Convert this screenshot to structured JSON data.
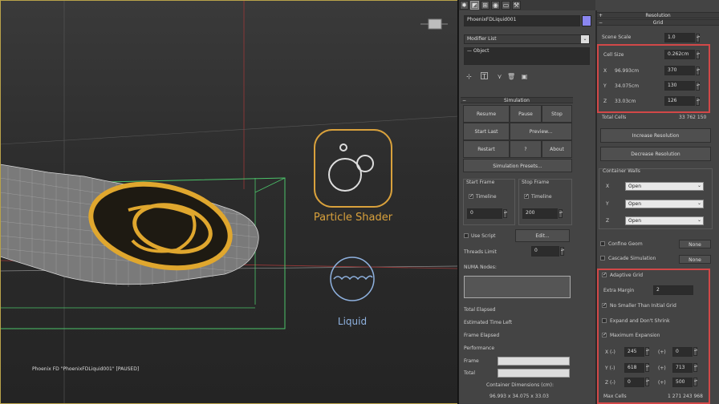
{
  "viewport": {
    "status_text": "Phoenix FD \"PhoenixFDLiquid001\" [PAUSED]",
    "particle_shader_label": "Particle Shader",
    "liquid_label": "Liquid"
  },
  "command_panel": {
    "tabs": [
      "create-icon",
      "modify-icon",
      "hierarchy-icon",
      "motion-icon",
      "display-icon",
      "utilities-icon"
    ],
    "object_name": "PhoenixFDLiquid001",
    "object_color": "#8a86f0",
    "modifier_list": "Modifier List",
    "stack_item": "Object",
    "stack_tools": [
      "pin-stack-icon",
      "show-end-result-icon",
      "make-unique-icon",
      "remove-modifier-icon",
      "configure-sets-icon"
    ]
  },
  "simulation": {
    "header": "Simulation",
    "buttons": {
      "resume": "Resume",
      "pause": "Pause",
      "stop": "Stop",
      "start_last": "Start Last",
      "preview": "Preview...",
      "restart": "Restart",
      "help": "?",
      "about": "About",
      "sim_presets": "Simulation Presets..."
    },
    "start_frame": {
      "label": "Start Frame",
      "timeline_label": "Timeline",
      "timeline_checked": true,
      "value": "0"
    },
    "stop_frame": {
      "label": "Stop Frame",
      "timeline_label": "Timeline",
      "timeline_checked": true,
      "value": "200"
    },
    "use_script": {
      "label": "Use Script",
      "checked": false,
      "edit_label": "Edit..."
    },
    "threads_limit": {
      "label": "Threads Limit",
      "value": "0"
    },
    "numa_nodes": "NUMA Nodes:",
    "stats": {
      "total_elapsed": "Total Elapsed",
      "estimated_time_left": "Estimated Time Left",
      "frame_elapsed": "Frame Elapsed",
      "performance": "Performance",
      "frame": "Frame",
      "total": "Total",
      "frame_progress": 0,
      "total_progress": 0
    },
    "container_dims_label": "Container Dimensions (cm):",
    "container_dims_value": "96.993 x 34.075 x 33.03"
  },
  "grid": {
    "resolution_header": "Resolution",
    "grid_header": "Grid",
    "scene_scale": {
      "label": "Scene Scale",
      "value": "1.0"
    },
    "cell_size": {
      "label": "Cell Size",
      "value": "0.262cm"
    },
    "x": {
      "label": "X",
      "size": "96.993cm",
      "value": "370"
    },
    "y": {
      "label": "Y",
      "size": "34.075cm",
      "value": "130"
    },
    "z": {
      "label": "Z",
      "size": "33.03cm",
      "value": "126"
    },
    "total_cells": {
      "label": "Total Cells",
      "value": "33 762 150"
    },
    "increase_resolution": "Increase Resolution",
    "decrease_resolution": "Decrease Resolution",
    "container_walls": {
      "label": "Container Walls",
      "x": {
        "label": "X",
        "value": "Open"
      },
      "y": {
        "label": "Y",
        "value": "Open"
      },
      "z": {
        "label": "Z",
        "value": "Open"
      }
    },
    "confine_geom": {
      "label": "Confine Geom",
      "checked": false,
      "value": "None"
    },
    "cascade_sim": {
      "label": "Cascade Simulation",
      "checked": false,
      "value": "None"
    },
    "adaptive": {
      "adaptive_grid": {
        "label": "Adaptive Grid",
        "checked": true
      },
      "extra_margin": {
        "label": "Extra Margin",
        "value": "2"
      },
      "no_smaller": {
        "label": "No Smaller Than Initial Grid",
        "checked": true
      },
      "expand_dont_shrink": {
        "label": "Expand and Don't Shrink",
        "checked": false
      },
      "max_expansion": {
        "label": "Maximum Expansion",
        "checked": true
      },
      "rows": [
        {
          "label": "X (-)",
          "neg": "245",
          "plus_label": "(+)",
          "pos": "0"
        },
        {
          "label": "Y (-)",
          "neg": "618",
          "plus_label": "(+)",
          "pos": "713"
        },
        {
          "label": "Z (-)",
          "neg": "0",
          "plus_label": "(+)",
          "pos": "500"
        }
      ],
      "max_cells": {
        "label": "Max Cells",
        "value": "1 271 243 968"
      }
    }
  }
}
